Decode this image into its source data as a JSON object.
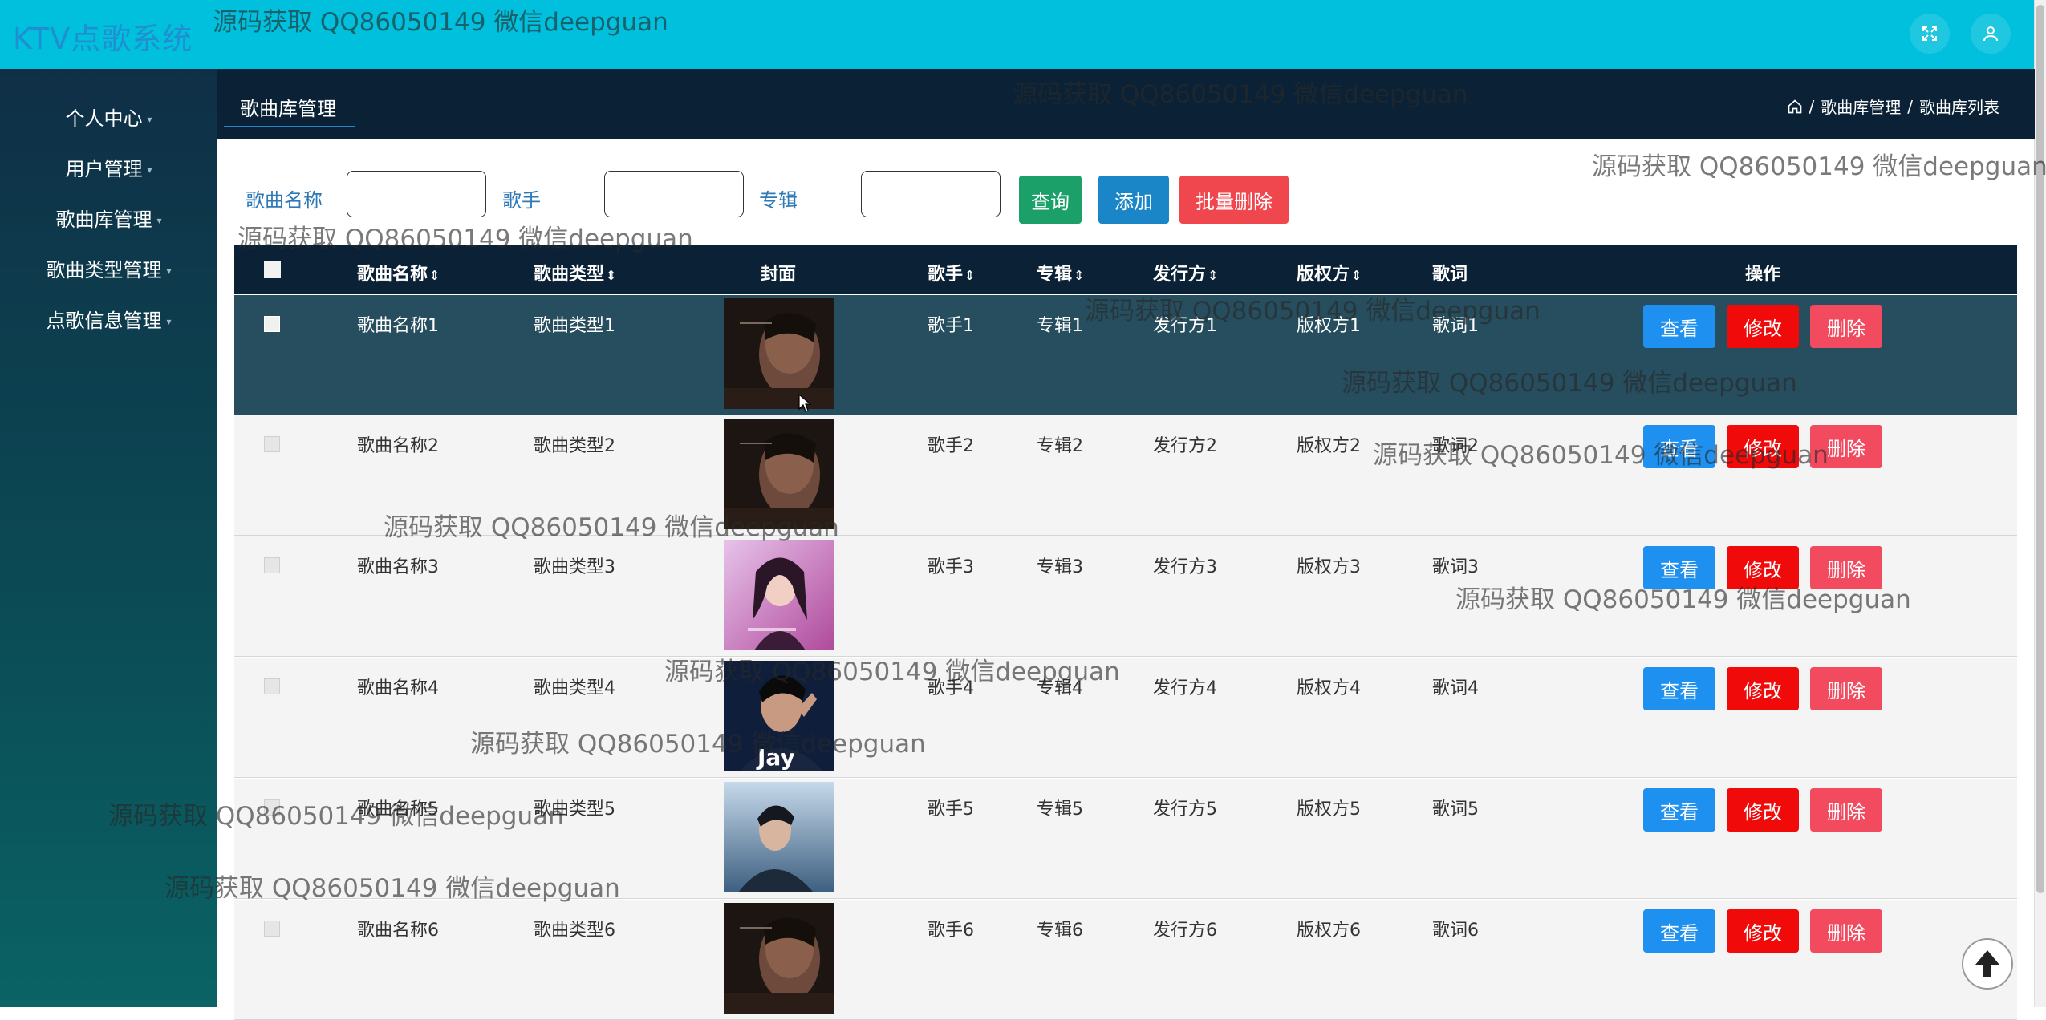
{
  "app": {
    "title": "KTV点歌系统"
  },
  "header": {
    "fullscreen_icon": "fullscreen-icon",
    "user_icon": "user-icon"
  },
  "sidebar": {
    "items": [
      {
        "label": "个人中心"
      },
      {
        "label": "用户管理"
      },
      {
        "label": "歌曲库管理"
      },
      {
        "label": "歌曲类型管理"
      },
      {
        "label": "点歌信息管理"
      }
    ]
  },
  "subheader": {
    "tab_label": "歌曲库管理",
    "breadcrumb": {
      "home_icon": "home-icon",
      "sep": "/",
      "level1": "歌曲库管理",
      "level2": "歌曲库列表"
    }
  },
  "search": {
    "song_name_label": "歌曲名称",
    "song_name_value": "",
    "singer_label": "歌手",
    "singer_value": "",
    "album_label": "专辑",
    "album_value": "",
    "query_button": "查询",
    "add_button": "添加",
    "batch_delete_button": "批量删除"
  },
  "table": {
    "headers": {
      "name": "歌曲名称",
      "type": "歌曲类型",
      "cover": "封面",
      "singer": "歌手",
      "album": "专辑",
      "publisher": "发行方",
      "copyright": "版权方",
      "lyrics": "歌词",
      "ops": "操作"
    },
    "sort_glyph": "⇕",
    "actions": {
      "view": "查看",
      "edit": "修改",
      "delete": "删除"
    },
    "rows": [
      {
        "name": "歌曲名称1",
        "type": "歌曲类型1",
        "singer": "歌手1",
        "album": "专辑1",
        "publisher": "发行方1",
        "copyright": "版权方1",
        "lyrics": "歌词1",
        "cover": "dark-portrait"
      },
      {
        "name": "歌曲名称2",
        "type": "歌曲类型2",
        "singer": "歌手2",
        "album": "专辑2",
        "publisher": "发行方2",
        "copyright": "版权方2",
        "lyrics": "歌词2",
        "cover": "dark-portrait"
      },
      {
        "name": "歌曲名称3",
        "type": "歌曲类型3",
        "singer": "歌手3",
        "album": "专辑3",
        "publisher": "发行方3",
        "copyright": "版权方3",
        "lyrics": "歌词3",
        "cover": "pink-portrait"
      },
      {
        "name": "歌曲名称4",
        "type": "歌曲类型4",
        "singer": "歌手4",
        "album": "专辑4",
        "publisher": "发行方4",
        "copyright": "版权方4",
        "lyrics": "歌词4",
        "cover": "jay-portrait",
        "cover_text": "Jay"
      },
      {
        "name": "歌曲名称5",
        "type": "歌曲类型5",
        "singer": "歌手5",
        "album": "专辑5",
        "publisher": "发行方5",
        "copyright": "版权方5",
        "lyrics": "歌词5",
        "cover": "blue-portrait"
      },
      {
        "name": "歌曲名称6",
        "type": "歌曲类型6",
        "singer": "歌手6",
        "album": "专辑6",
        "publisher": "发行方6",
        "copyright": "版权方6",
        "lyrics": "歌词6",
        "cover": "dark-portrait"
      }
    ]
  },
  "watermark": {
    "text": "源码获取 QQ86050149 微信deepguan"
  },
  "colors": {
    "topbar": "#00c0dd",
    "sidebar": "#0b3b4c",
    "subheader": "#0b2236",
    "selected_row": "#264e5e",
    "query": "#1aa068",
    "add": "#1a86c8",
    "batch_delete": "#f0474f",
    "view": "#1e90f0",
    "edit": "#f00a0a",
    "delete": "#f24a5e"
  }
}
